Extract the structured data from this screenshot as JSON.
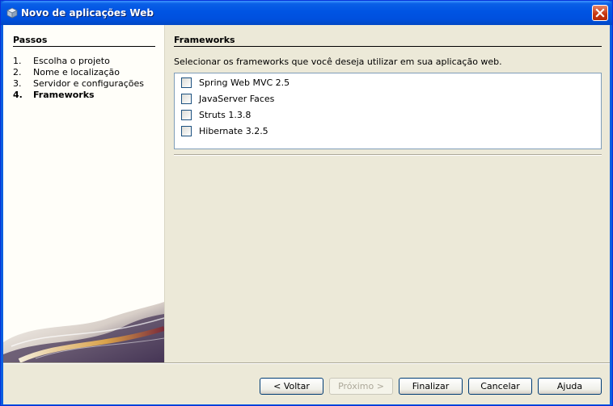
{
  "window": {
    "title": "Novo de aplicações Web",
    "icon": "netbeans-cube-icon",
    "close_icon": "close-icon"
  },
  "steps": {
    "title": "Passos",
    "items": [
      {
        "num": "1.",
        "label": "Escolha o projeto",
        "current": false
      },
      {
        "num": "2.",
        "label": "Nome e localização",
        "current": false
      },
      {
        "num": "3.",
        "label": "Servidor e configurações",
        "current": false
      },
      {
        "num": "4.",
        "label": "Frameworks",
        "current": true
      }
    ]
  },
  "frameworks": {
    "title": "Frameworks",
    "description": "Selecionar os frameworks que você deseja utilizar em sua aplicação web.",
    "items": [
      {
        "label": "Spring Web MVC 2.5",
        "checked": false
      },
      {
        "label": "JavaServer Faces",
        "checked": false
      },
      {
        "label": "Struts 1.3.8",
        "checked": false
      },
      {
        "label": "Hibernate 3.2.5",
        "checked": false
      }
    ]
  },
  "buttons": {
    "back": "< Voltar",
    "next": "Próximo >",
    "finish": "Finalizar",
    "cancel": "Cancelar",
    "help": "Ajuda"
  }
}
